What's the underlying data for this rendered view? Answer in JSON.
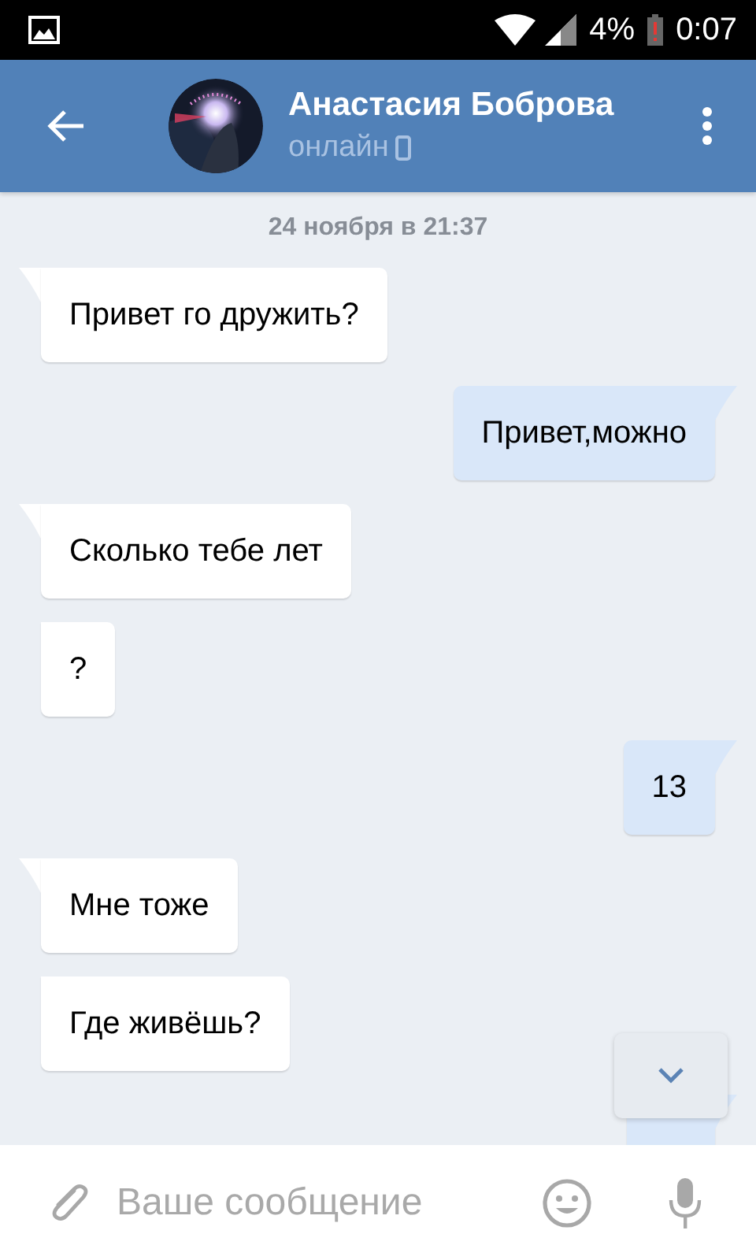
{
  "status_bar": {
    "battery": "4%",
    "time": "0:07"
  },
  "header": {
    "name": "Анастасия Боброва",
    "status": "онлайн"
  },
  "date": "24 ноября в 21:37",
  "messages": [
    {
      "kind": "in",
      "tail": true,
      "text": "Привет го дружить?"
    },
    {
      "kind": "out",
      "tail": true,
      "text": "Привет,можно"
    },
    {
      "kind": "in",
      "tail": true,
      "text": "Сколько тебе лет"
    },
    {
      "kind": "in",
      "tail": false,
      "text": "?"
    },
    {
      "kind": "out",
      "tail": true,
      "text": "13"
    },
    {
      "kind": "in",
      "tail": true,
      "text": "Мне тоже"
    },
    {
      "kind": "in",
      "tail": false,
      "text": "Где живёшь?"
    },
    {
      "kind": "out",
      "tail": true
    }
  ],
  "composer": {
    "placeholder": "Ваше сообщение"
  }
}
